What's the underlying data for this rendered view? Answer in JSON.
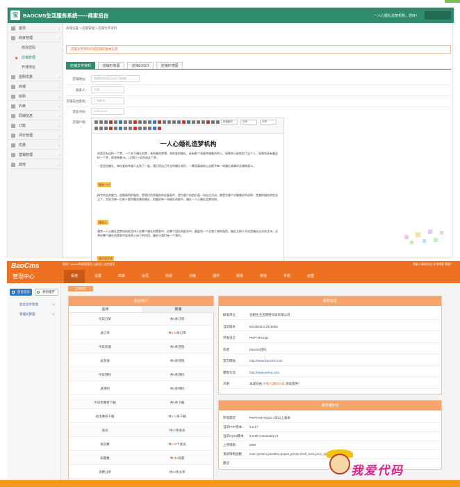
{
  "p1": {
    "title": "BAOCMS生活服务系统——商家后台",
    "user": "一人心婚礼造梦机构，您好！",
    "sidebar": [
      {
        "label": "首页",
        "icon": "home-icon"
      },
      {
        "label": "商家管理",
        "icon": "store-icon"
      },
      {
        "label": "修改密码",
        "sub": true
      },
      {
        "label": "店铺管理",
        "sub": true,
        "active": true
      },
      {
        "label": "开通地址",
        "sub": true
      },
      {
        "label": "团购优惠",
        "icon": "tag-icon"
      },
      {
        "label": "商城",
        "icon": "cart-icon"
      },
      {
        "label": "抢购",
        "icon": "clock-icon"
      },
      {
        "label": "外卖",
        "icon": "bowl-icon"
      },
      {
        "label": "同城信息",
        "icon": "info-icon"
      },
      {
        "label": "订座",
        "icon": "seat-icon"
      },
      {
        "label": "评价管理",
        "icon": "star-icon"
      },
      {
        "label": "优惠",
        "icon": "coupon-icon"
      },
      {
        "label": "营销管理",
        "icon": "chart-icon"
      },
      {
        "label": "其他",
        "icon": "more-icon"
      }
    ],
    "breadcrumb": "商城设置 > 店铺管理 > 店铺文字资料",
    "alert": "店铺文字资料介绍店铺的基本信息",
    "tabs": [
      "店铺文字资料",
      "店铺形象图",
      "店铺LOGO",
      "店铺环境图"
    ],
    "form": {
      "addr_label": "店铺地址：",
      "addr_ph": "合肥市包河区万达广场B座",
      "contact_label": "联系人：",
      "contact_ph": "大器",
      "phone_label": "店铺前台座机：",
      "phone_ph": "广场前台",
      "hours_label": "营业时间：",
      "hours_ph": "8:00-19:00",
      "intro_label": "店铺介绍："
    },
    "editor": {
      "selects": [
        "段落格式",
        "字体",
        "字号"
      ],
      "heading": "一人心婚礼造梦机构",
      "p1": "你是否有这样一个梦，一个关于婚礼的梦，有你最的梦想，有你爱的婚礼，还有那个承载幸福象你的人，如果你已经找到了这个人，如果你还有着这样一个梦，那就带着TA，让我们一起完成这个梦。",
      "p2": "一直坚信婚礼，每份爱的幸福人走到了一起，我们用自己专业的婚礼知识，一颗用真诚的心去赋予每一场婚礼故事的灵魂和意义。",
      "tag1": "服务一心",
      "p3": "精专的业务能力，热情周到的服务，是我们优质服务的必备条件，是为客户创造价值一场礼仪活动，都是为客户对最美好的诠释，完美的服务的信念之下，实现为每一位新人提供最完美的婚礼，把握好每一场婚礼的细节，婚礼一人心婚礼造梦机构。",
      "tag2": "服务入",
      "p4": "通常一人心婚礼造梦机构的主持人在整个婚礼的策划中，在整个团队的配合中，都起到一个灵魂人物的角色，婚礼主持人不仅是婚礼仪式的主持，还将在整个婚礼的策划中起到承上启下的作用，最好与我们有一个预约。",
      "tag3": "婚礼服务单"
    }
  },
  "p2": {
    "logo": "BaoCms",
    "subtitle": "管理中心",
    "welcome": "您好！admin系统管理员 | [退出] | 站点首页",
    "right_links": "升级人事站点化  支持博客  帮助？",
    "nav": [
      "系统",
      "设置",
      "商家",
      "会员",
      "商城",
      "功能",
      "插件",
      "频道",
      "微信",
      "手机",
      "运营"
    ],
    "buttons": [
      "后台首页",
      "更新缓存"
    ],
    "side_items": [
      "后台菜单管理",
      "管理员管理"
    ],
    "crumb": "后台首页",
    "stats": {
      "title": "后台统计",
      "col1": "名称",
      "col2": "数量",
      "rows": [
        {
          "k": "今日订单",
          "pre": "共",
          "n": "0",
          "suf": "条订单"
        },
        {
          "k": "总订单",
          "pre": "共",
          "n": "172",
          "suf": "条订单"
        },
        {
          "k": "今日充值",
          "pre": "共",
          "n": "0",
          "suf": "条充值"
        },
        {
          "k": "总充值",
          "pre": "共",
          "n": "0",
          "suf": "条充值"
        },
        {
          "k": "今日预约",
          "pre": "共",
          "n": "0",
          "suf": "条预约"
        },
        {
          "k": "总预约",
          "pre": "共",
          "n": "0",
          "suf": "条预约"
        },
        {
          "k": "今日优惠券下载",
          "pre": "共",
          "n": "0",
          "suf": "条下载"
        },
        {
          "k": "总优惠券下载",
          "pre": "共",
          "n": "171",
          "suf": "条下载"
        },
        {
          "k": "会员",
          "pre": "共",
          "n": "37",
          "suf": "条会员"
        },
        {
          "k": "会员数",
          "pre": "共",
          "n": "140",
          "suf": "个会员"
        },
        {
          "k": "商家数",
          "pre": "共",
          "n": "112",
          "suf": "商家"
        },
        {
          "k": "消费分享",
          "pre": "共",
          "n": "20",
          "suf": "条分享"
        }
      ]
    },
    "version": {
      "title": "版权信息",
      "rows": [
        {
          "k": "研发单位",
          "v": "合肥生活宝网络科技有限公司"
        },
        {
          "k": "当前版本",
          "v": "BAOBU6.0.2015906"
        },
        {
          "k": "开发语言",
          "v": "PHP+MYSQL"
        },
        {
          "k": "作者",
          "v": "baocms团队"
        },
        {
          "k": "官方网站",
          "v": "http://www.baocms.com",
          "link": true
        },
        {
          "k": "爆客交流",
          "v": "http://www.eenot.com",
          "link": true
        },
        {
          "k": "声明",
          "v": "本源码由 ",
          "v2": "外星人源码论坛",
          "v3": " 测试提供！"
        }
      ]
    },
    "server": {
      "title": "服务器环境",
      "rows": [
        {
          "k": "环境需求",
          "v": "PHP5+MYSQL5.1及以上版本"
        },
        {
          "k": "当前PHP版本",
          "v": "5.2.17"
        },
        {
          "k": "当前mysql版本",
          "v": "5.0.96-community-nt"
        },
        {
          "k": "上传限制",
          "v": "20M"
        },
        {
          "k": "系统限制函数",
          "v": "exec,system,passthru,popen,pclose,shell_exec,proc_open,dl,chmod"
        },
        {
          "k": "建议",
          "v": ""
        }
      ]
    }
  },
  "watermark": "我爱代码"
}
